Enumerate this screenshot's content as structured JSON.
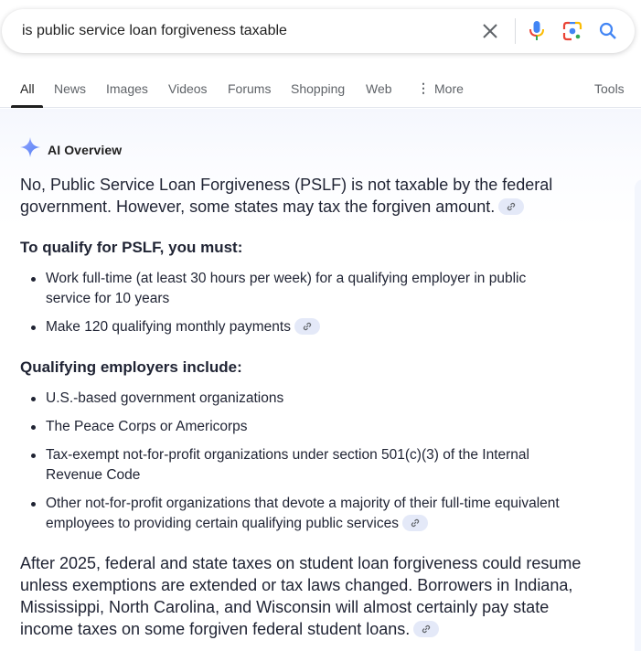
{
  "search": {
    "query": "is public service loan forgiveness taxable",
    "icons": [
      "close-icon",
      "microphone-icon",
      "google-lens-icon",
      "search-icon"
    ]
  },
  "tabs": {
    "items": [
      {
        "label": "All",
        "active": true
      },
      {
        "label": "News"
      },
      {
        "label": "Images"
      },
      {
        "label": "Videos"
      },
      {
        "label": "Forums"
      },
      {
        "label": "Shopping"
      },
      {
        "label": "Web"
      },
      {
        "label": "More"
      }
    ],
    "tools_label": "Tools"
  },
  "ai_overview": {
    "title": "AI Overview",
    "intro": "No, Public Service Loan Forgiveness (PSLF) is not taxable by the federal government. However, some states may tax the forgiven amount.",
    "qualify_heading": "To qualify for PSLF, you must:",
    "qualify_items": [
      "Work full-time (at least 30 hours per week) for a qualifying employer in public service for 10 years",
      "Make 120 qualifying monthly payments"
    ],
    "employers_heading": "Qualifying employers include:",
    "employers_items": [
      "U.S.-based government organizations",
      "The Peace Corps or Americorps",
      "Tax-exempt not-for-profit organizations under section 501(c)(3) of the Internal Revenue Code",
      "Other not-for-profit organizations that devote a majority of their full-time equivalent employees to providing certain qualifying public services"
    ],
    "outro": "After 2025, federal and state taxes on student loan forgiveness could resume unless exemptions are extended or tax laws changed. Borrowers in Indiana, Mississippi, North Carolina, and Wisconsin will almost certainly pay state income taxes on some forgiven federal student loans."
  },
  "colors": {
    "accent_blue": "#4285f4",
    "link_chip_bg": "#e4e9f8",
    "text_dark": "#1f2333",
    "tab_inactive": "#5f6368"
  }
}
